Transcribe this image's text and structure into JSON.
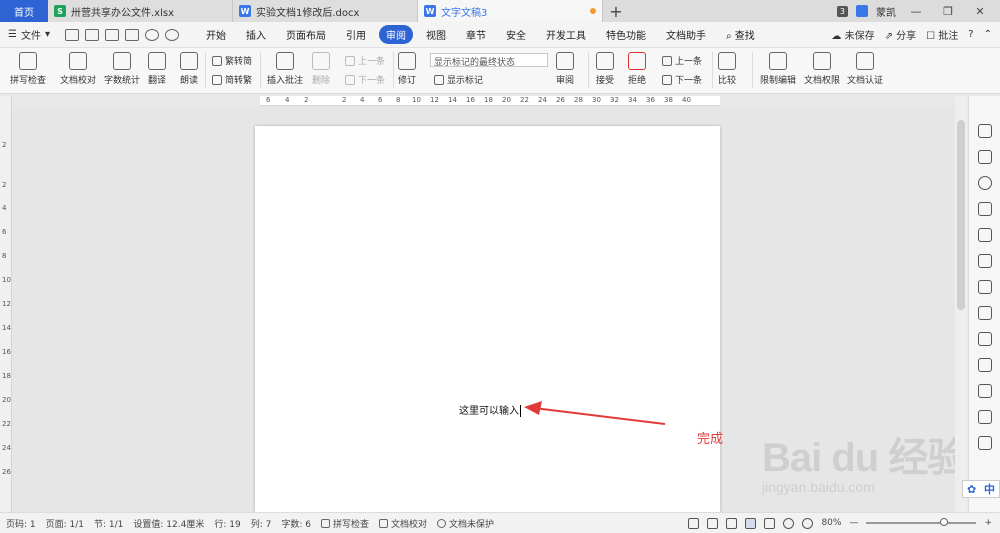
{
  "tabs": {
    "home": "首页",
    "docs": [
      {
        "name": "卅营共享办公文件.xlsx",
        "type": "S",
        "active": false
      },
      {
        "name": "实验文档1修改后.docx",
        "type": "W",
        "active": false
      },
      {
        "name": "文字文稿3",
        "type": "W",
        "active": true
      }
    ],
    "new_tab": "+",
    "badge": "3",
    "user": "蒙凯"
  },
  "window": {
    "minimize": "—",
    "restore": "❐",
    "close": "✕"
  },
  "menu": {
    "file": "文件",
    "items": [
      "开始",
      "插入",
      "页面布局",
      "引用",
      "审阅",
      "视图",
      "章节",
      "安全",
      "开发工具",
      "特色功能",
      "文档助手"
    ],
    "active": "审阅",
    "search": "查找",
    "unsaved": "未保存",
    "share": "分享",
    "comment": "批注",
    "help": "?"
  },
  "ribbon": {
    "spell_check": "拼写检查",
    "doc_proof": "文档校对",
    "word_count": "字数统计",
    "translate": "翻译",
    "read_aloud": "朗读",
    "trad_to_simp": "繁转简",
    "simp_to_trad": "简转繁",
    "insert_comment": "插入批注",
    "delete": "删除",
    "prev_comment": "上一条",
    "next_comment": "下一条",
    "track_changes": "修订",
    "markup_select": "显示标记的最终状态",
    "show_markup": "显示标记",
    "review": "审阅",
    "accept": "接受",
    "reject": "拒绝",
    "prev_change": "上一条",
    "next_change": "下一条",
    "compare": "比较",
    "restrict_edit": "限制编辑",
    "doc_permission": "文档权限",
    "doc_cert": "文档认证"
  },
  "ruler": {
    "h": [
      "6",
      "4",
      "2",
      "",
      "2",
      "4",
      "6",
      "8",
      "10",
      "12",
      "14",
      "16",
      "18",
      "20",
      "22",
      "24",
      "26",
      "28",
      "30",
      "32",
      "34",
      "36",
      "38",
      "40"
    ],
    "v": [
      "",
      "2",
      "",
      "2",
      "4",
      "6",
      "8",
      "10",
      "12",
      "14",
      "16",
      "18",
      "20",
      "22",
      "24",
      "26"
    ]
  },
  "document": {
    "typed_text": "这里可以输入"
  },
  "annotation": {
    "label": "完成",
    "color": "#e03a3a"
  },
  "watermark": {
    "logo": "Bai du 经验",
    "url": "jingyan.baidu.com"
  },
  "ime": {
    "label": "中"
  },
  "status": {
    "page_num": "页码: 1",
    "pages": "页面: 1/1",
    "section": "节: 1/1",
    "setting": "设置值: 12.4厘米",
    "row": "行: 19",
    "col": "列: 7",
    "words": "字数: 6",
    "spell": "拼写检查",
    "proof": "文档校对",
    "protect": "文档未保护",
    "zoom": "80%",
    "zoom_level": 0.72,
    "zoom_minus": "—",
    "zoom_plus": "+"
  },
  "colors": {
    "accent": "#2e63d3",
    "arrow": "#e03a3a"
  }
}
